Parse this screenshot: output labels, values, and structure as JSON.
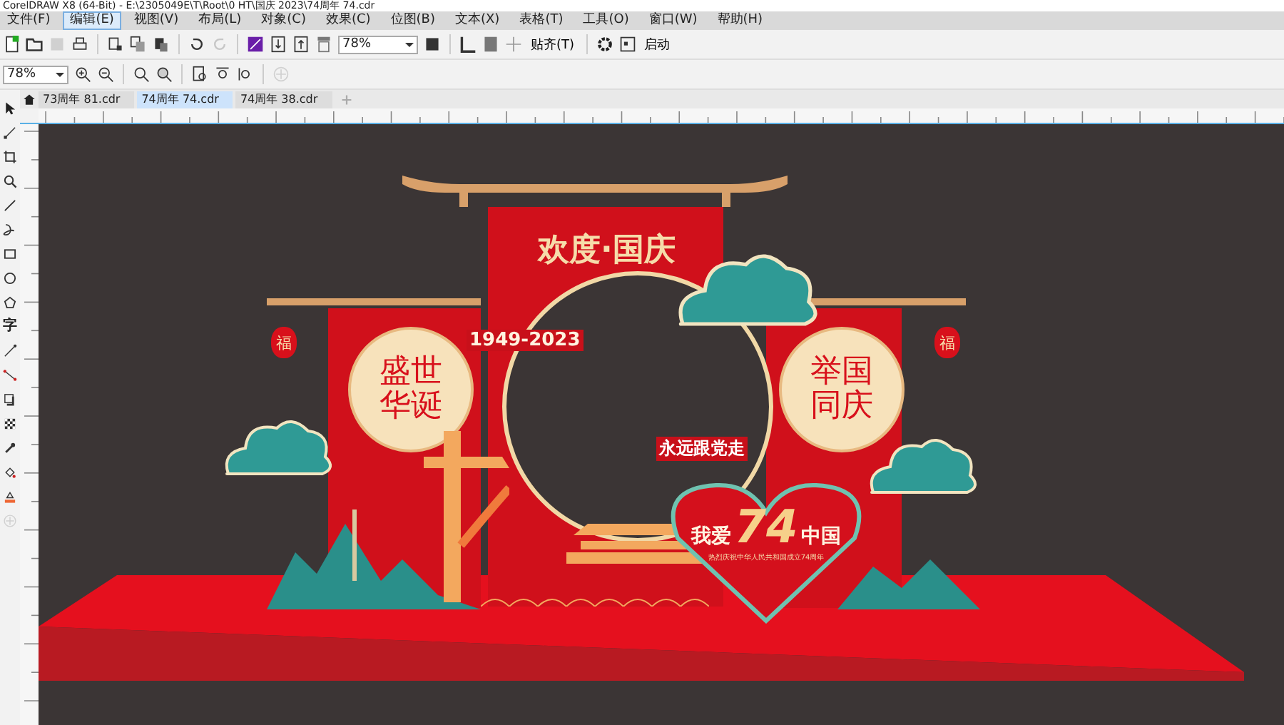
{
  "window": {
    "title": "CorelDRAW X8 (64-Bit) - E:\\2305049E\\T\\Root\\0 HT\\国庆 2023\\74周年 74.cdr"
  },
  "menu": [
    {
      "label": "文件(F)",
      "selected": false
    },
    {
      "label": "编辑(E)",
      "selected": true
    },
    {
      "label": "视图(V)",
      "selected": false
    },
    {
      "label": "布局(L)",
      "selected": false
    },
    {
      "label": "对象(C)",
      "selected": false
    },
    {
      "label": "效果(C)",
      "selected": false
    },
    {
      "label": "位图(B)",
      "selected": false
    },
    {
      "label": "文本(X)",
      "selected": false
    },
    {
      "label": "表格(T)",
      "selected": false
    },
    {
      "label": "工具(O)",
      "selected": false
    },
    {
      "label": "窗口(W)",
      "selected": false
    },
    {
      "label": "帮助(H)",
      "selected": false
    }
  ],
  "toolbar": {
    "zoom": "78%",
    "snap": "贴齐(T)",
    "launch": "启动"
  },
  "property_bar": {
    "zoom": "78%"
  },
  "tabs": [
    {
      "label": "73周年 81.cdr",
      "selected": false
    },
    {
      "label": "74周年 74.cdr",
      "selected": true
    },
    {
      "label": "74周年 38.cdr",
      "selected": false
    }
  ],
  "toolbox": {
    "text_tool": "字"
  },
  "artwork": {
    "title": "欢度·国庆",
    "years": "1949-2023",
    "left_motto": "盛世华诞",
    "right_motto": "举国同庆",
    "slogan": "永远跟党走",
    "lantern_left": "福",
    "lantern_right": "福",
    "heart": {
      "left": "我爱",
      "number": "74",
      "right": "中国",
      "subtitle": "热烈庆祝中华人民共和国成立74周年"
    }
  }
}
